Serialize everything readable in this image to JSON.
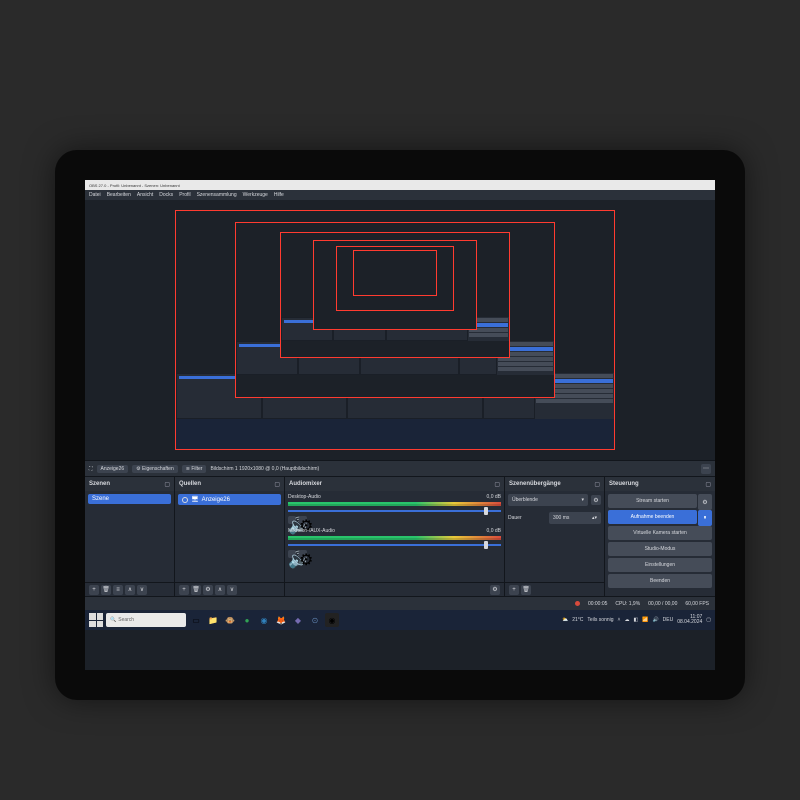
{
  "window": {
    "title": "OBS 27.0 - Profil: Unbenannt - Szenen: Unbenannt"
  },
  "menu": [
    "Datei",
    "Bearbeiten",
    "Ansicht",
    "Docks",
    "Profil",
    "Szenensammlung",
    "Werkzeuge",
    "Hilfe"
  ],
  "toolbar": {
    "source_chip": "Anzeige26",
    "properties": "Eigenschaften",
    "filters": "Filter",
    "resolution": "Bildschirm 1 1920x1080 @ 0,0 (Hauptbildschirm)"
  },
  "docks": {
    "scenes": {
      "title": "Szenen",
      "items": [
        "Szene"
      ]
    },
    "sources": {
      "title": "Quellen",
      "items": [
        "Anzeige26"
      ]
    },
    "mixer": {
      "title": "Audiomixer",
      "channels": [
        {
          "name": "Desktop-Audio",
          "db": "0,0 dB",
          "thumb": 92
        },
        {
          "name": "Mikrofon-/AUX-Audio",
          "db": "0,0 dB",
          "thumb": 92
        }
      ],
      "settings_icon": "⚙"
    },
    "transitions": {
      "title": "Szenenübergänge",
      "transition_label": "Überblende",
      "duration_label": "Dauer",
      "duration_value": "300 ms"
    },
    "controls": {
      "title": "Steuerung",
      "buttons": {
        "start_stream": "Stream starten",
        "stop_record": "Aufnahme beenden",
        "virtual_cam": "Virtuelle Kamera starten",
        "studio": "Studio-Modus",
        "settings": "Einstellungen",
        "exit": "Beenden"
      }
    }
  },
  "status": {
    "recording_time": "00:00:05",
    "cpu": "CPU: 1,9%",
    "disk": "00,00 / 00,00",
    "fps": "60,00 FPS"
  },
  "taskbar": {
    "search_placeholder": "Search",
    "weather_temp": "21°C",
    "weather_text": "Teils sonnig",
    "time": "11:07",
    "date": "08.04.2024"
  }
}
